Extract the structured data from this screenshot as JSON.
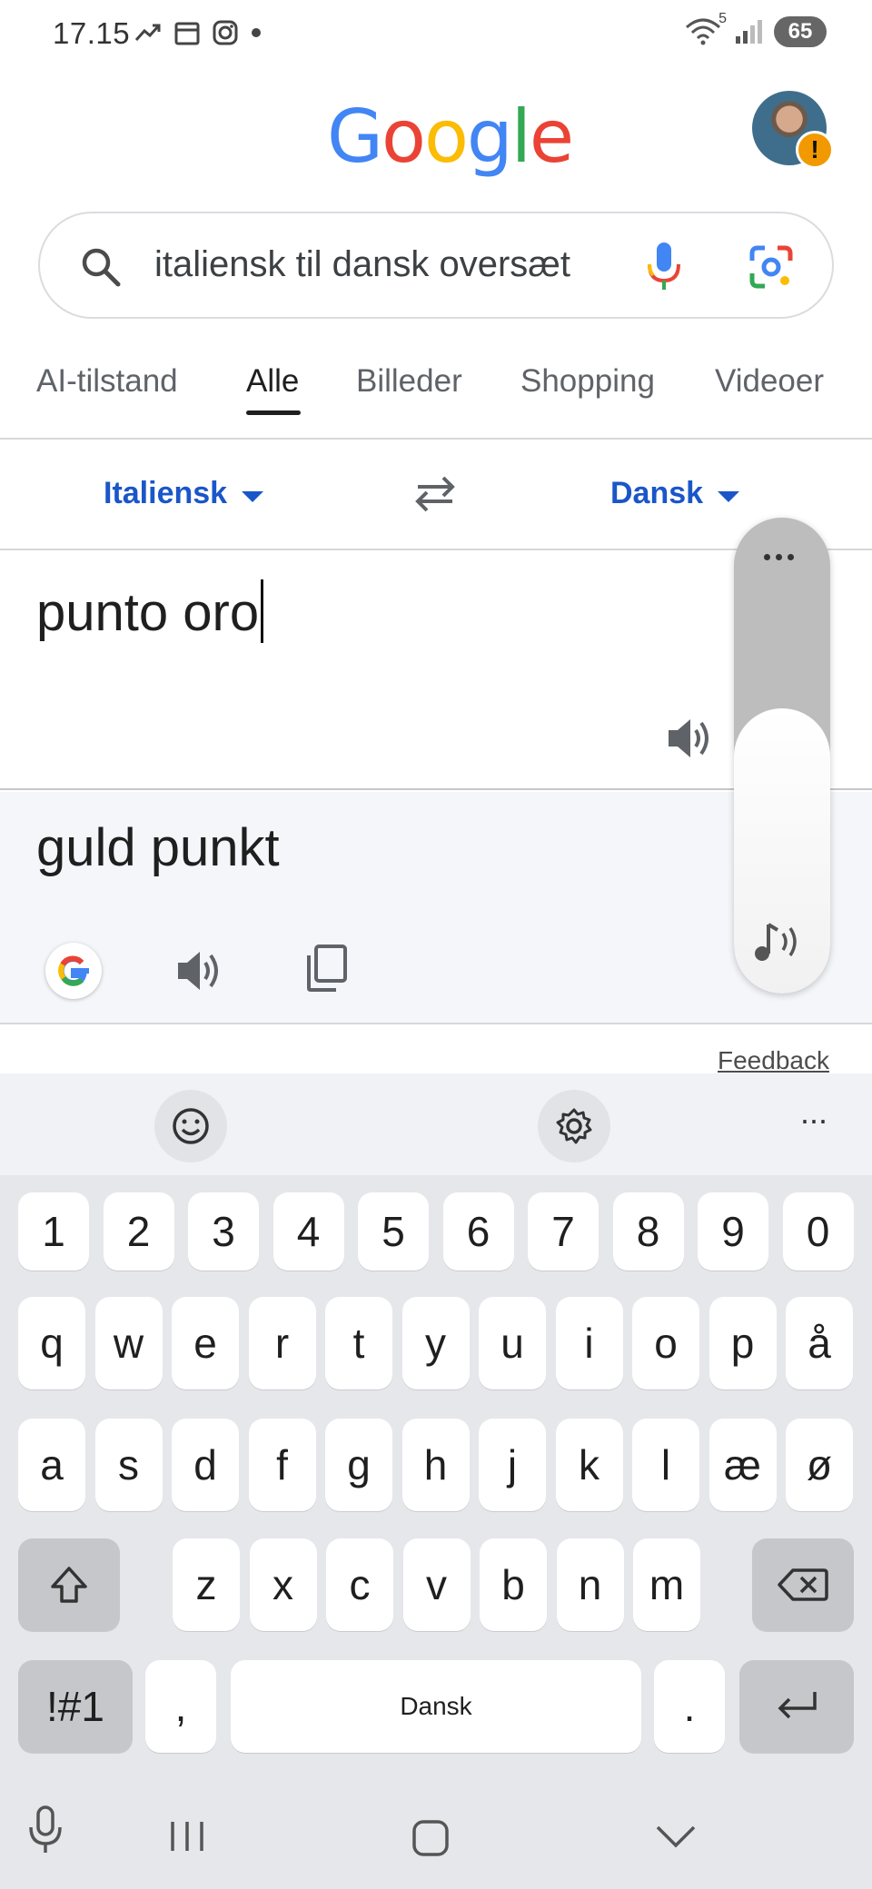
{
  "status_bar": {
    "time": "17.15",
    "wifi_badge": "5",
    "battery": "65"
  },
  "header": {
    "logo_letters": [
      {
        "ch": "G",
        "color": "#4285F4"
      },
      {
        "ch": "o",
        "color": "#EA4335"
      },
      {
        "ch": "o",
        "color": "#FBBC05"
      },
      {
        "ch": "g",
        "color": "#4285F4"
      },
      {
        "ch": "l",
        "color": "#34A853"
      },
      {
        "ch": "e",
        "color": "#EA4335"
      }
    ],
    "avatar_warning": "!"
  },
  "search": {
    "query": "italiensk til dansk oversæt"
  },
  "tabs": [
    "AI-tilstand",
    "Alle",
    "Billeder",
    "Shopping",
    "Videoer"
  ],
  "active_tab": "Alle",
  "translate": {
    "source_lang": "Italiensk",
    "target_lang": "Dansk",
    "input_text": "punto oro",
    "output_text": "guld punkt",
    "feedback": "Feedback"
  },
  "keyboard": {
    "number_row": [
      "1",
      "2",
      "3",
      "4",
      "5",
      "6",
      "7",
      "8",
      "9",
      "0"
    ],
    "row1": [
      "q",
      "w",
      "e",
      "r",
      "t",
      "y",
      "u",
      "i",
      "o",
      "p",
      "å"
    ],
    "row2": [
      "a",
      "s",
      "d",
      "f",
      "g",
      "h",
      "j",
      "k",
      "l",
      "æ",
      "ø"
    ],
    "row3": [
      "z",
      "x",
      "c",
      "v",
      "b",
      "n",
      "m"
    ],
    "symbols_key": "!#1",
    "comma_key": ",",
    "space_label": "Dansk",
    "period_key": ".",
    "toolbar_more": "···"
  },
  "colors": {
    "link_blue": "#1a56c8",
    "accent": "#1f1f1f"
  }
}
